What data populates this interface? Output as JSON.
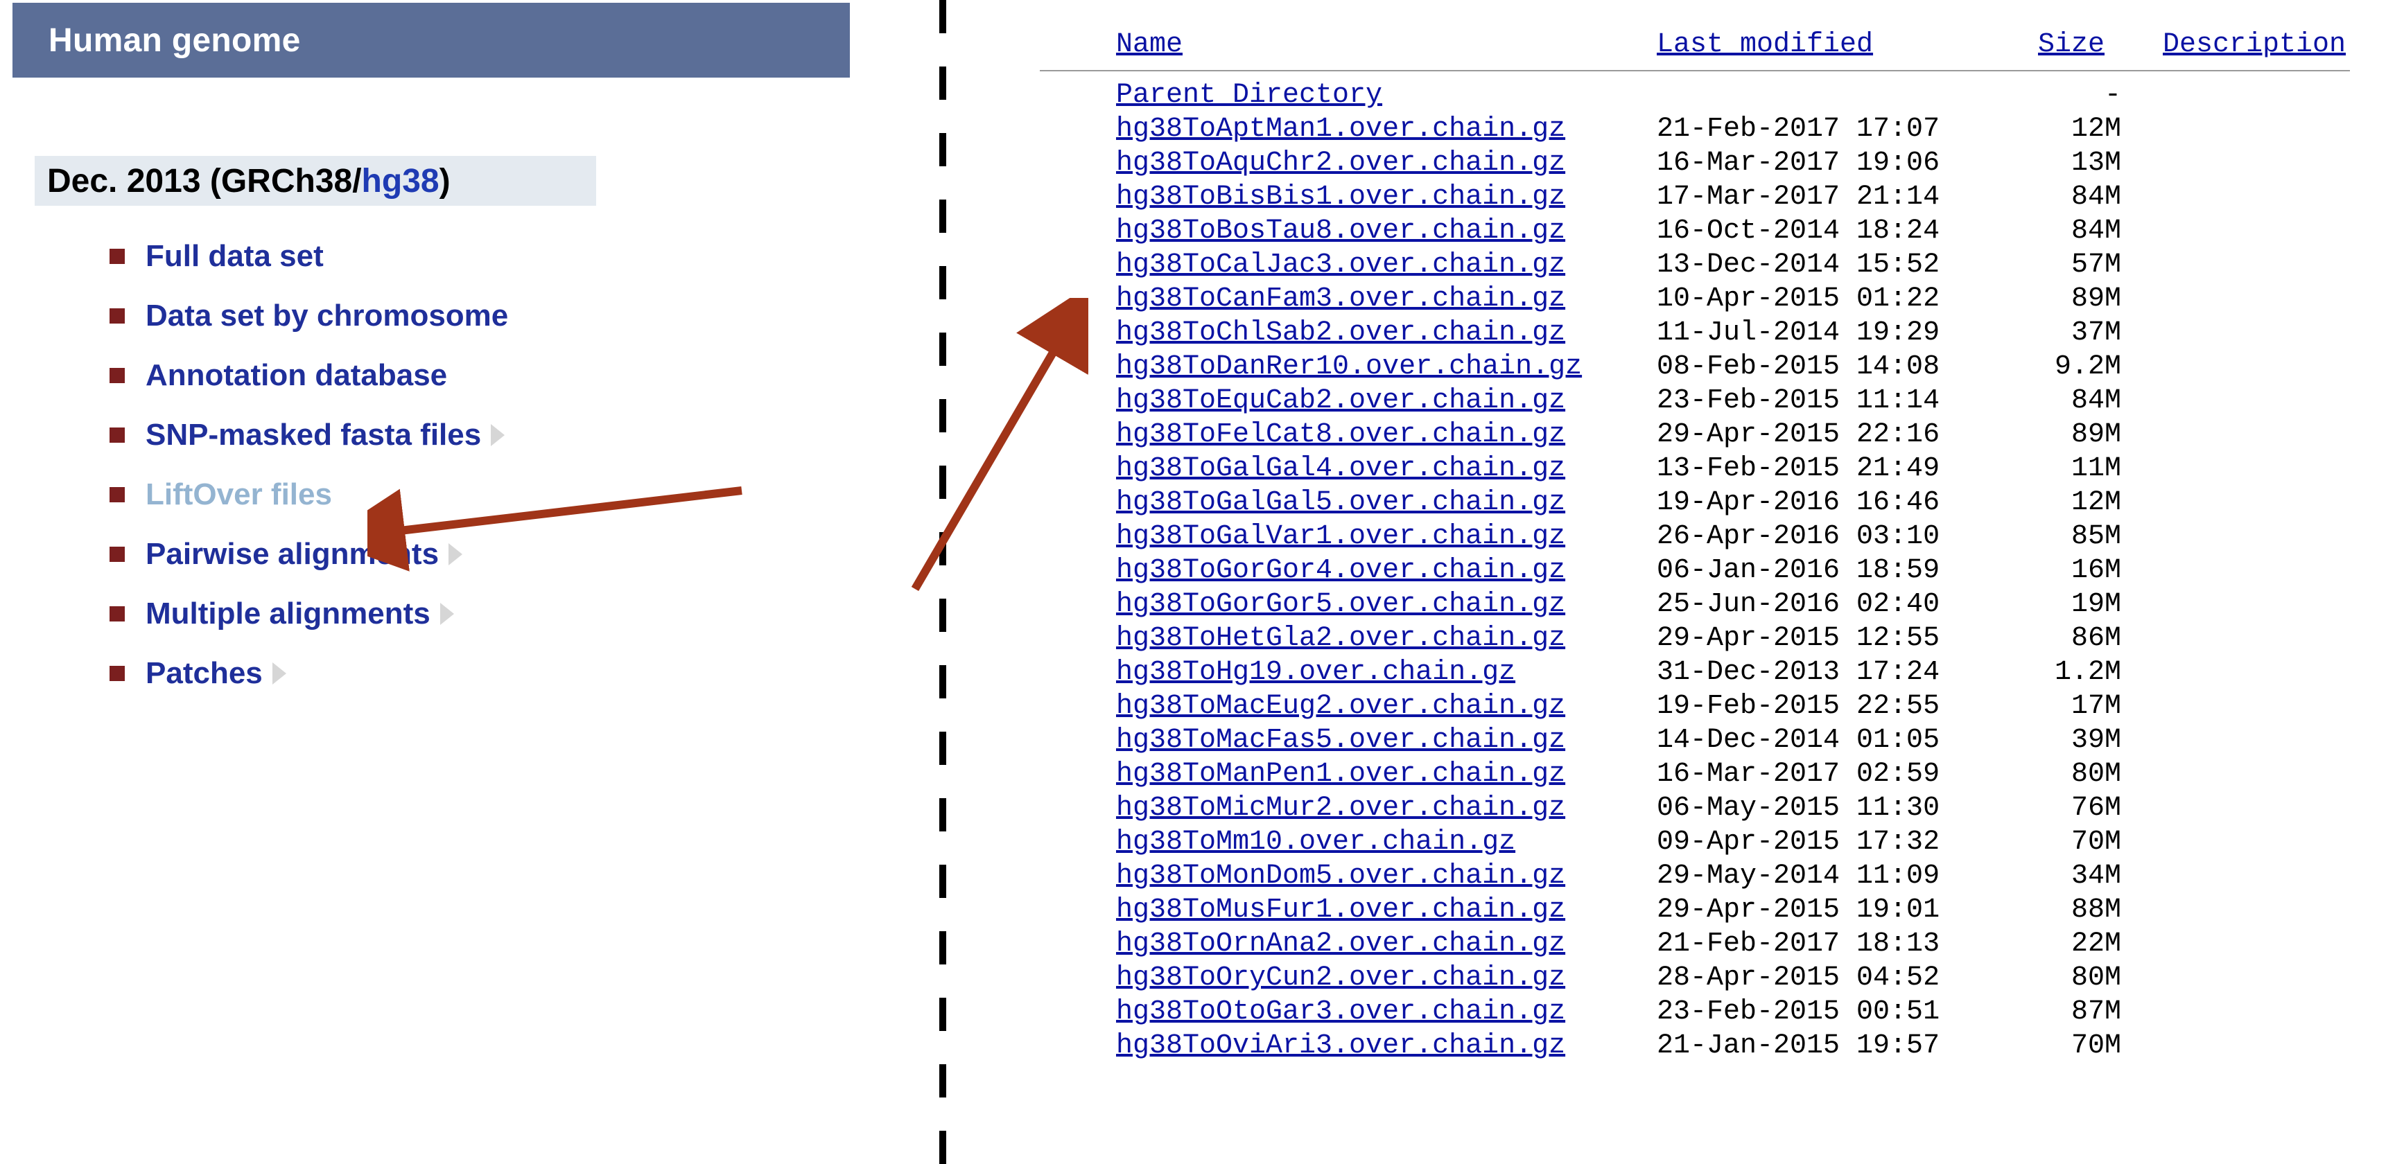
{
  "banner": {
    "title": "Human genome"
  },
  "release": {
    "prefix": "Dec. 2013 (GRCh38/",
    "assembly": "hg38",
    "suffix": ")"
  },
  "menu": [
    {
      "label": "Full data set",
      "has_tri": false,
      "current": false
    },
    {
      "label": "Data set by chromosome",
      "has_tri": false,
      "current": false
    },
    {
      "label": "Annotation database",
      "has_tri": false,
      "current": false
    },
    {
      "label": "SNP-masked fasta files",
      "has_tri": true,
      "current": false
    },
    {
      "label": "LiftOver files",
      "has_tri": false,
      "current": true
    },
    {
      "label": "Pairwise alignments",
      "has_tri": true,
      "current": false
    },
    {
      "label": "Multiple alignments",
      "has_tri": true,
      "current": false
    },
    {
      "label": "Patches",
      "has_tri": true,
      "current": false
    }
  ],
  "listing": {
    "headers": {
      "name": "Name",
      "modified": "Last modified",
      "size": "Size",
      "desc": "Description"
    },
    "parent": "Parent Directory",
    "parent_size": "-",
    "files": [
      {
        "name": "hg38ToAptMan1.over.chain.gz",
        "mod": "21-Feb-2017 17:07",
        "size": "12M"
      },
      {
        "name": "hg38ToAquChr2.over.chain.gz",
        "mod": "16-Mar-2017 19:06",
        "size": "13M"
      },
      {
        "name": "hg38ToBisBis1.over.chain.gz",
        "mod": "17-Mar-2017 21:14",
        "size": "84M"
      },
      {
        "name": "hg38ToBosTau8.over.chain.gz",
        "mod": "16-Oct-2014 18:24",
        "size": "84M"
      },
      {
        "name": "hg38ToCalJac3.over.chain.gz",
        "mod": "13-Dec-2014 15:52",
        "size": "57M"
      },
      {
        "name": "hg38ToCanFam3.over.chain.gz",
        "mod": "10-Apr-2015 01:22",
        "size": "89M"
      },
      {
        "name": "hg38ToChlSab2.over.chain.gz",
        "mod": "11-Jul-2014 19:29",
        "size": "37M"
      },
      {
        "name": "hg38ToDanRer10.over.chain.gz",
        "mod": "08-Feb-2015 14:08",
        "size": "9.2M"
      },
      {
        "name": "hg38ToEquCab2.over.chain.gz",
        "mod": "23-Feb-2015 11:14",
        "size": "84M"
      },
      {
        "name": "hg38ToFelCat8.over.chain.gz",
        "mod": "29-Apr-2015 22:16",
        "size": "89M"
      },
      {
        "name": "hg38ToGalGal4.over.chain.gz",
        "mod": "13-Feb-2015 21:49",
        "size": "11M"
      },
      {
        "name": "hg38ToGalGal5.over.chain.gz",
        "mod": "19-Apr-2016 16:46",
        "size": "12M"
      },
      {
        "name": "hg38ToGalVar1.over.chain.gz",
        "mod": "26-Apr-2016 03:10",
        "size": "85M"
      },
      {
        "name": "hg38ToGorGor4.over.chain.gz",
        "mod": "06-Jan-2016 18:59",
        "size": "16M"
      },
      {
        "name": "hg38ToGorGor5.over.chain.gz",
        "mod": "25-Jun-2016 02:40",
        "size": "19M"
      },
      {
        "name": "hg38ToHetGla2.over.chain.gz",
        "mod": "29-Apr-2015 12:55",
        "size": "86M"
      },
      {
        "name": "hg38ToHg19.over.chain.gz",
        "mod": "31-Dec-2013 17:24",
        "size": "1.2M"
      },
      {
        "name": "hg38ToMacEug2.over.chain.gz",
        "mod": "19-Feb-2015 22:55",
        "size": "17M"
      },
      {
        "name": "hg38ToMacFas5.over.chain.gz",
        "mod": "14-Dec-2014 01:05",
        "size": "39M"
      },
      {
        "name": "hg38ToManPen1.over.chain.gz",
        "mod": "16-Mar-2017 02:59",
        "size": "80M"
      },
      {
        "name": "hg38ToMicMur2.over.chain.gz",
        "mod": "06-May-2015 11:30",
        "size": "76M"
      },
      {
        "name": "hg38ToMm10.over.chain.gz",
        "mod": "09-Apr-2015 17:32",
        "size": "70M"
      },
      {
        "name": "hg38ToMonDom5.over.chain.gz",
        "mod": "29-May-2014 11:09",
        "size": "34M"
      },
      {
        "name": "hg38ToMusFur1.over.chain.gz",
        "mod": "29-Apr-2015 19:01",
        "size": "88M"
      },
      {
        "name": "hg38ToOrnAna2.over.chain.gz",
        "mod": "21-Feb-2017 18:13",
        "size": "22M"
      },
      {
        "name": "hg38ToOryCun2.over.chain.gz",
        "mod": "28-Apr-2015 04:52",
        "size": "80M"
      },
      {
        "name": "hg38ToOtoGar3.over.chain.gz",
        "mod": "23-Feb-2015 00:51",
        "size": "87M"
      },
      {
        "name": "hg38ToOviAri3.over.chain.gz",
        "mod": "21-Jan-2015 19:57",
        "size": "70M"
      }
    ]
  }
}
